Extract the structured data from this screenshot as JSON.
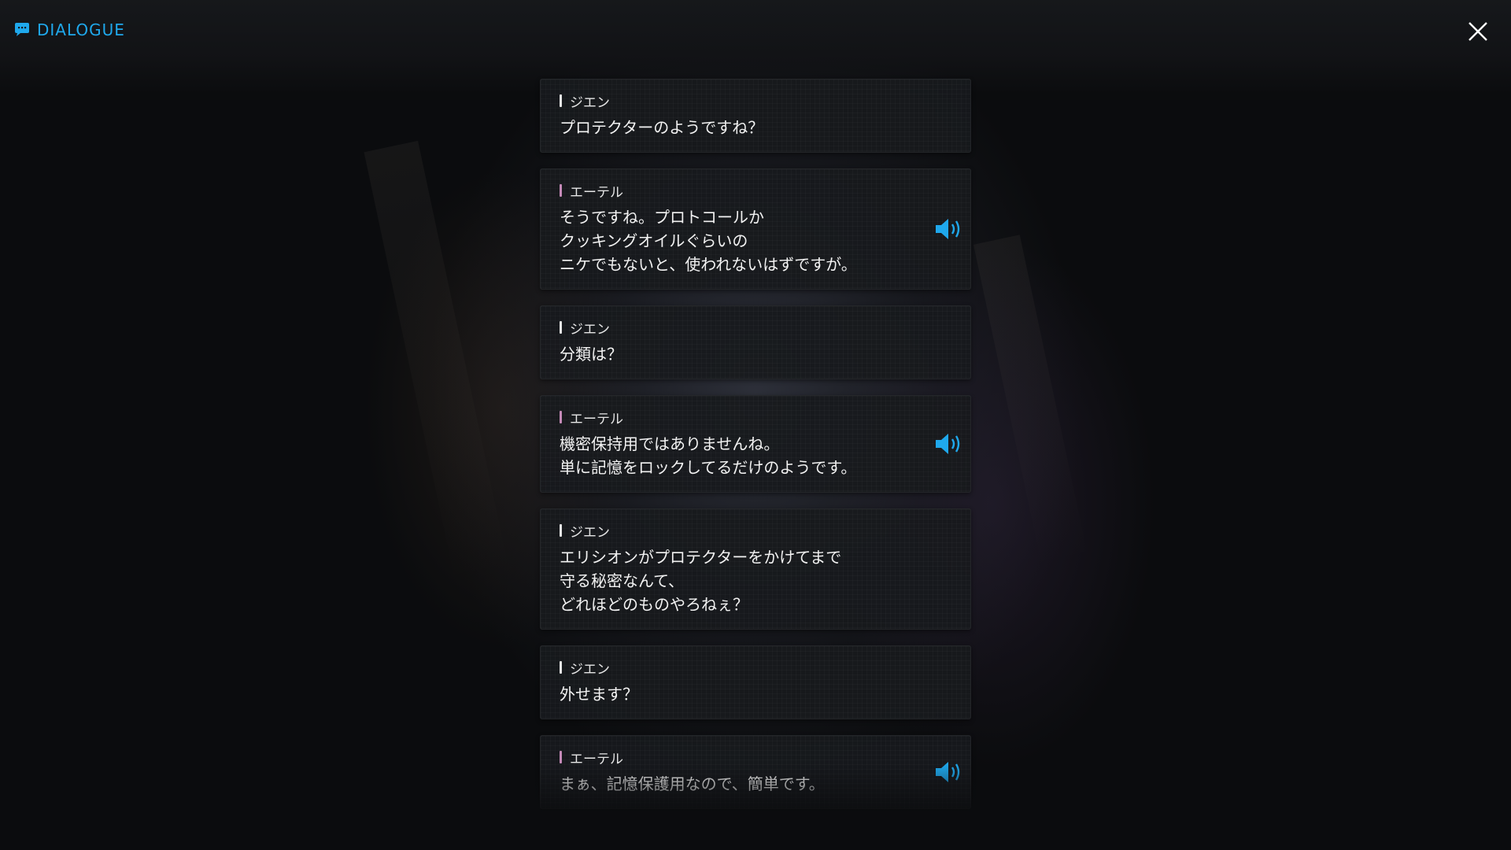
{
  "header": {
    "title": "DIALOGUE",
    "title_icon": "chat-bubble-icon",
    "close_icon": "close-icon"
  },
  "colors": {
    "accent": "#1fa8ec",
    "speaker_jien": "#e6e6e6",
    "speaker_ether": "#c58ab8"
  },
  "entries": [
    {
      "speaker": "ジエン",
      "text": "プロテクターのようですね？",
      "voice": false
    },
    {
      "speaker": "エーテル",
      "text": "そうですね。プロトコールか\nクッキングオイルぐらいの\nニケでもないと、使われないはずですが。",
      "voice": true
    },
    {
      "speaker": "ジエン",
      "text": "分類は？",
      "voice": false
    },
    {
      "speaker": "エーテル",
      "text": "機密保持用ではありませんね。\n単に記憶をロックしてるだけのようです。",
      "voice": true
    },
    {
      "speaker": "ジエン",
      "text": "エリシオンがプロテクターをかけてまで\n守る秘密なんて、\nどれほどのものやろねぇ？",
      "voice": false
    },
    {
      "speaker": "ジエン",
      "text": "外せます？",
      "voice": false
    },
    {
      "speaker": "エーテル",
      "text": "まぁ、記憶保護用なので、簡単です。",
      "voice": true
    }
  ]
}
